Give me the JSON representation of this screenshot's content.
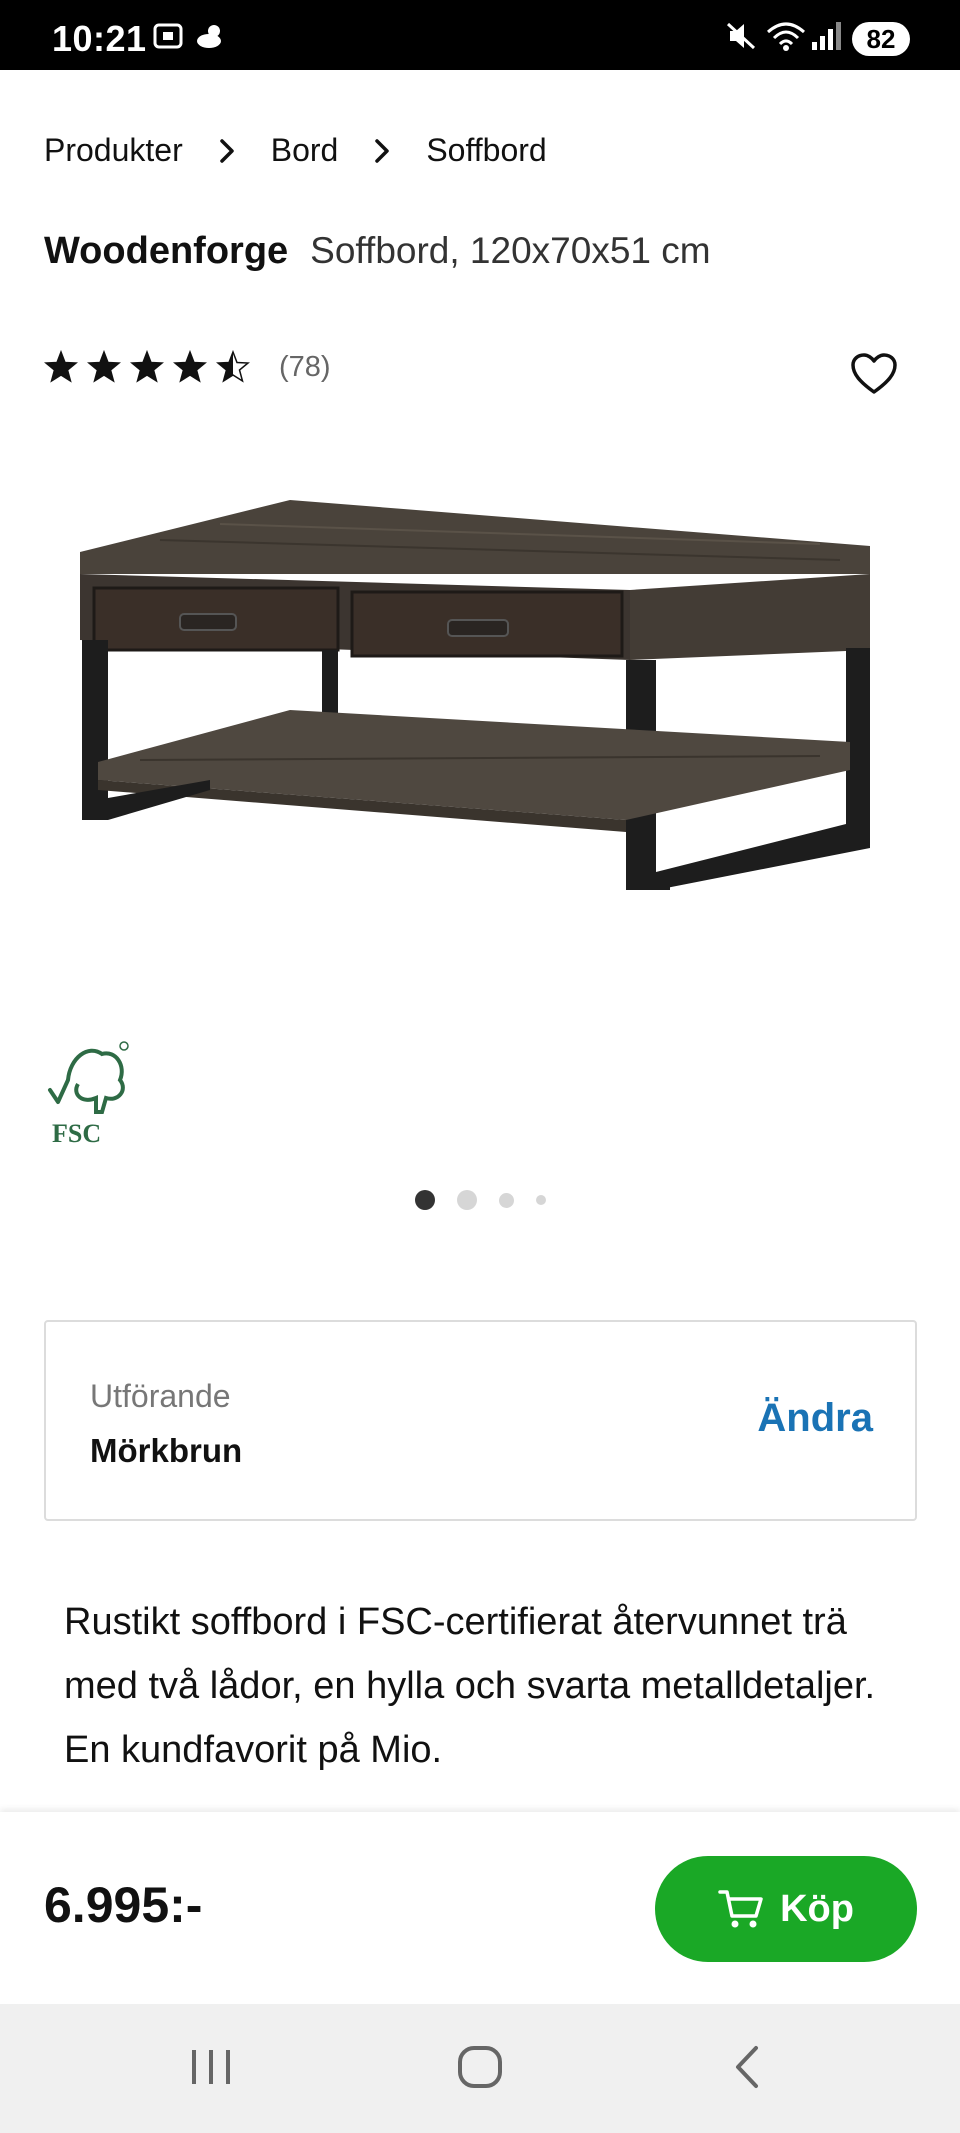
{
  "status_bar": {
    "time": "10:21",
    "battery": "82",
    "icons": [
      "screenshot-icon",
      "weather-icon",
      "mute-icon",
      "wifi-icon",
      "signal-icon"
    ]
  },
  "breadcrumb": {
    "items": [
      "Produkter",
      "Bord",
      "Soffbord"
    ]
  },
  "product": {
    "brand": "Woodenforge",
    "subtitle": "Soffbord, 120x70x51 cm",
    "rating": 4.5,
    "rating_max": 5,
    "review_count": "(78)",
    "image_icon": "coffee-table-image",
    "certification_logo": "FSC",
    "carousel": {
      "count": 4,
      "active": 0
    }
  },
  "variant": {
    "label": "Utförande",
    "value": "Mörkbrun",
    "change_label": "Ändra"
  },
  "description": "Rustikt soffbord i FSC-certifierat återvunnet trä med två lådor, en hylla och svarta metalldetaljer. En kundfavorit på Mio.",
  "buy_bar": {
    "price": "6.995:-",
    "buy_label": "Köp",
    "accent_color": "#1aa826"
  },
  "colors": {
    "link": "#1a73b5",
    "buy_button": "#1aa826"
  },
  "nav_bar": {
    "buttons": [
      "recent-apps-icon",
      "home-icon",
      "back-icon"
    ]
  }
}
